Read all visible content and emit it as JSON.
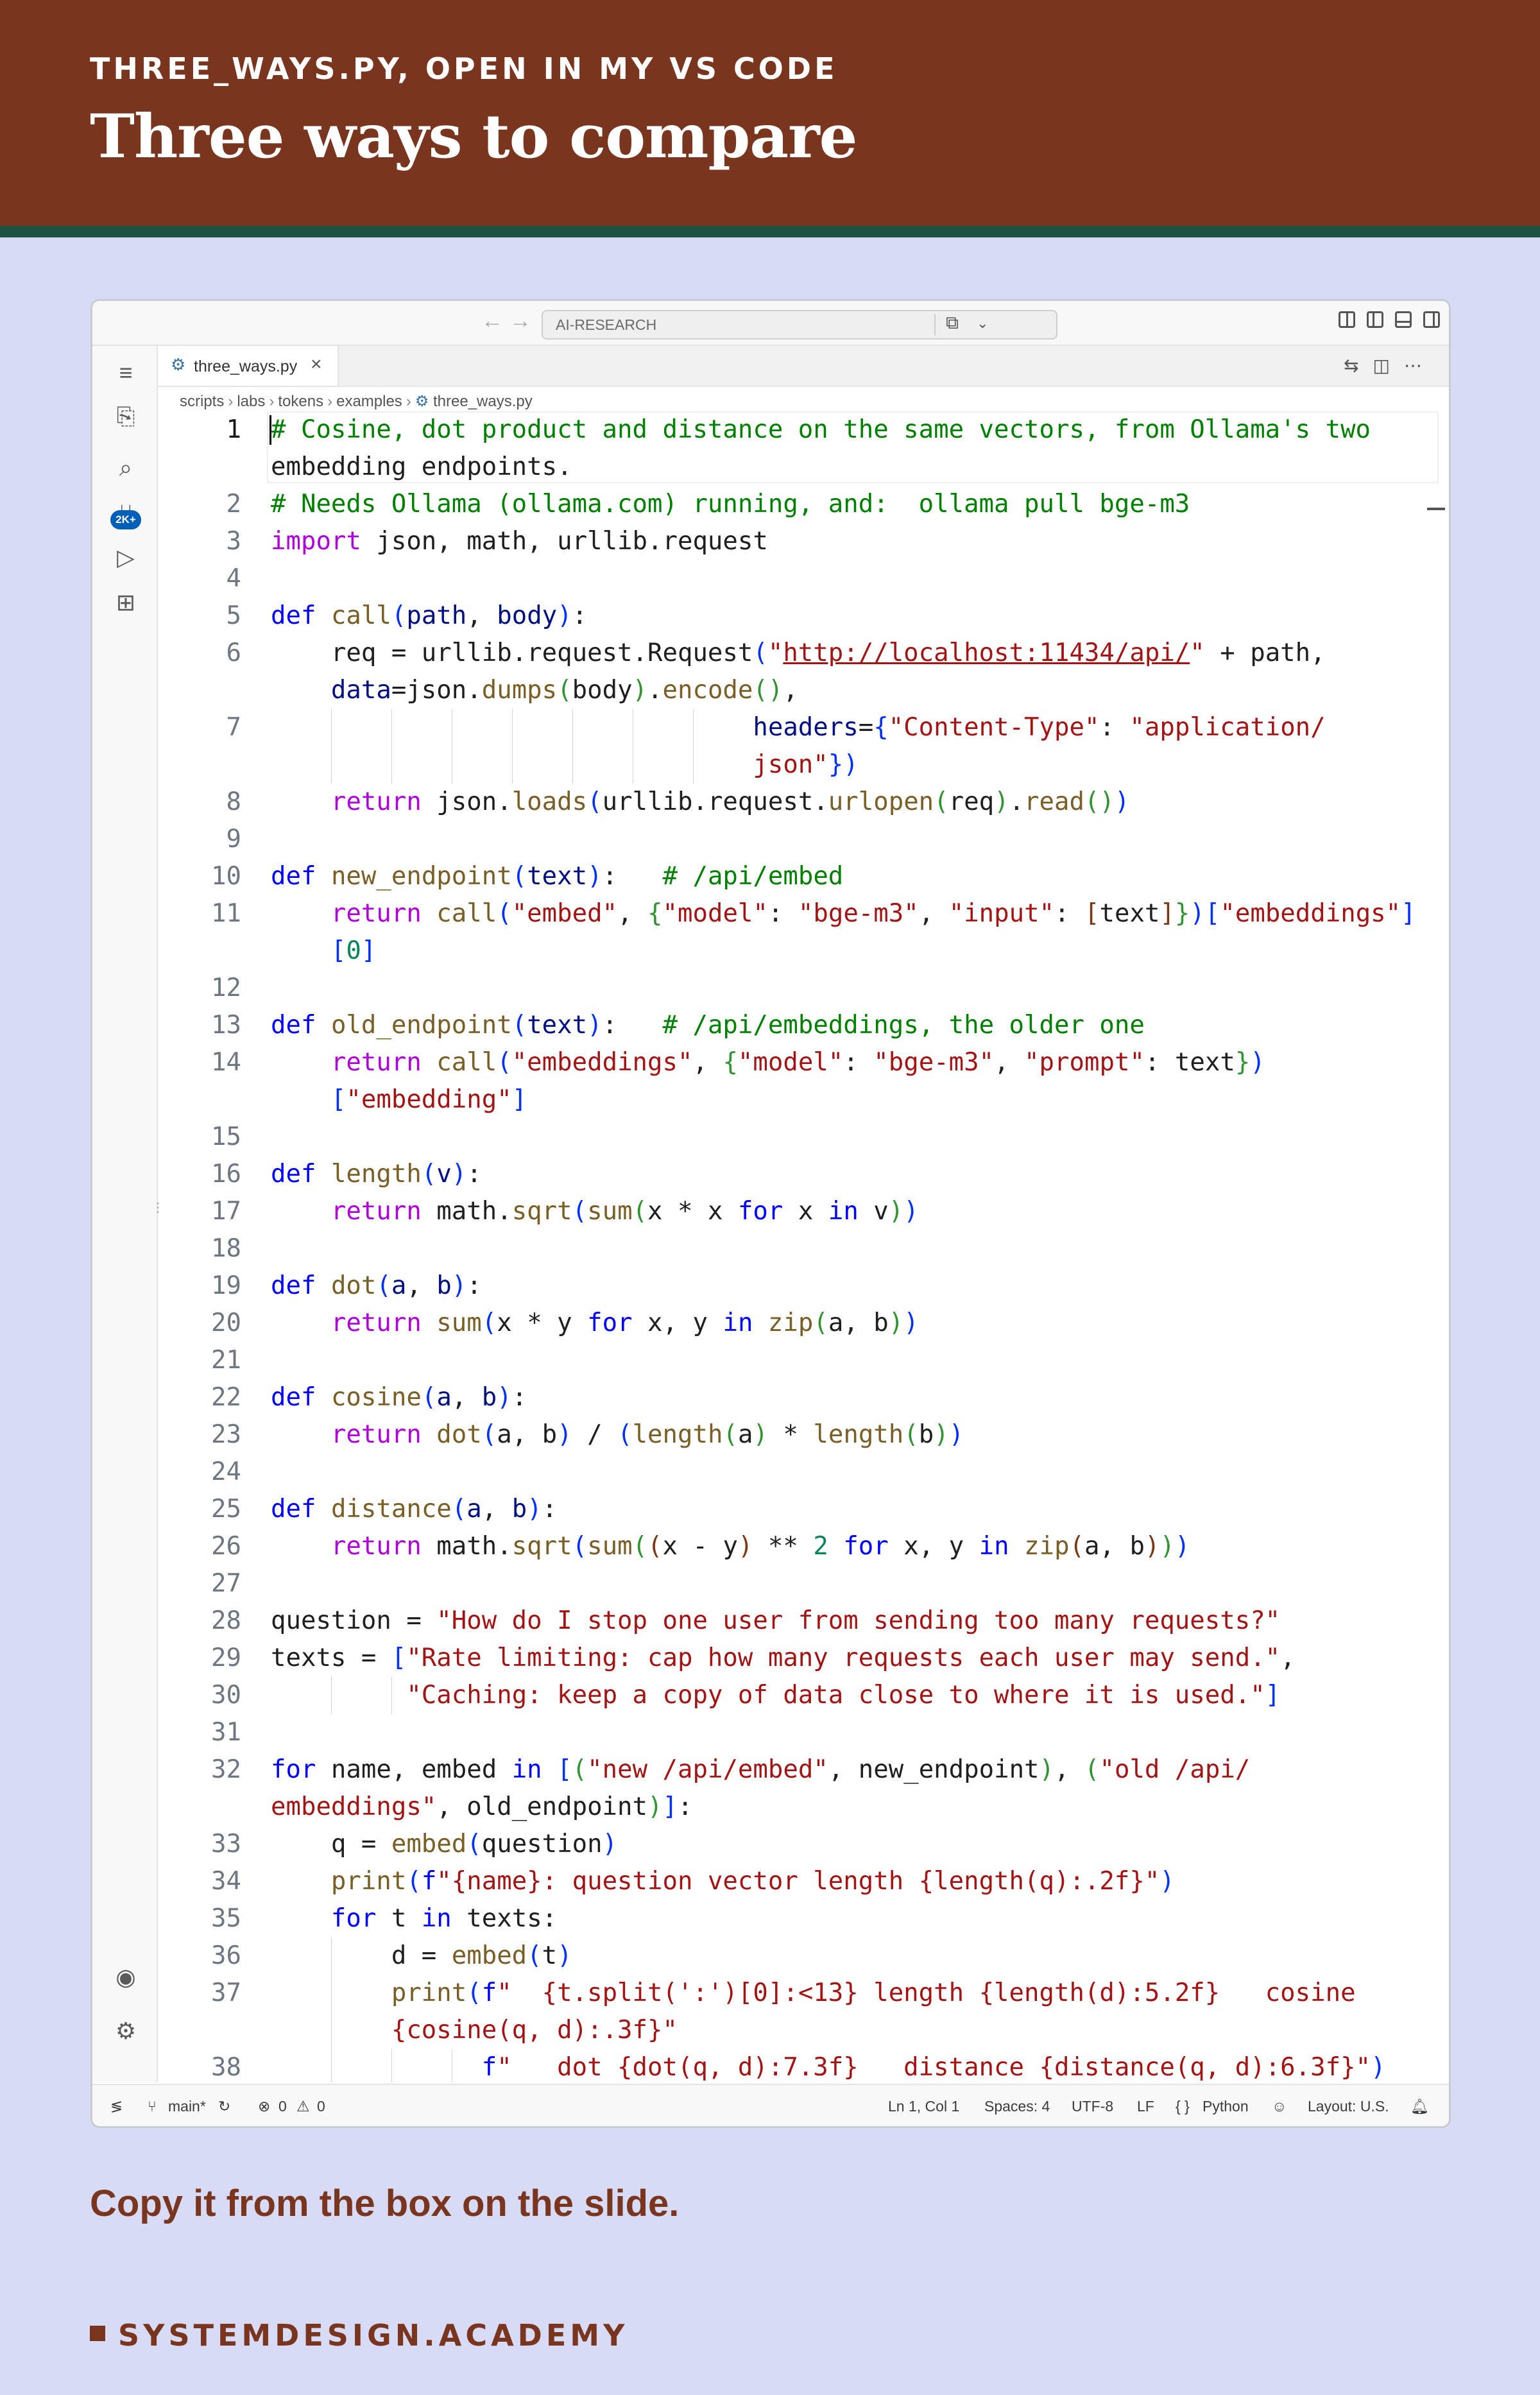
{
  "slide": {
    "eyebrow": "THREE_WAYS.PY, OPEN IN MY VS CODE",
    "title": "Three ways to compare",
    "caption": "Copy it from the box on the slide.",
    "footer": "SYSTEMDESIGN.ACADEMY",
    "colors": {
      "header": "#7a351e",
      "stripe": "#1d5140",
      "background": "#d8dbf6"
    }
  },
  "window": {
    "command_center": "AI-RESEARCH",
    "tab_label": "three_ways.py",
    "source_control_badge": "2K+",
    "breadcrumb": [
      "scripts",
      "labs",
      "tokens",
      "examples",
      "three_ways.py"
    ]
  },
  "status": {
    "branch": "main*",
    "errors": "0",
    "warnings": "0",
    "position": "Ln 1, Col 1",
    "spaces": "Spaces: 4",
    "encoding": "UTF-8",
    "eol": "LF",
    "language": "Python",
    "layout": "Layout: U.S."
  },
  "code": [
    {
      "n": "1",
      "text": "# Cosine, dot product and distance on the same vectors, from Ollama's two",
      "wrap": "embedding endpoints."
    },
    {
      "n": "2",
      "text": "# Needs Ollama (ollama.com) running, and:  ollama pull bge-m3"
    },
    {
      "n": "3",
      "text": "import json, math, urllib.request"
    },
    {
      "n": "4",
      "text": ""
    },
    {
      "n": "5",
      "text": "def call(path, body):"
    },
    {
      "n": "6",
      "text": "    req = urllib.request.Request(\"http://localhost:11434/api/\" + path,",
      "wrap": "    data=json.dumps(body).encode(),"
    },
    {
      "n": "7",
      "text": "                                headers={\"Content-Type\": \"application/",
      "wrap": "                                json\"})"
    },
    {
      "n": "8",
      "text": "    return json.loads(urllib.request.urlopen(req).read())"
    },
    {
      "n": "9",
      "text": ""
    },
    {
      "n": "10",
      "text": "def new_endpoint(text):   # /api/embed"
    },
    {
      "n": "11",
      "text": "    return call(\"embed\", {\"model\": \"bge-m3\", \"input\": [text]})[\"embeddings\"]",
      "wrap": "    [0]"
    },
    {
      "n": "12",
      "text": ""
    },
    {
      "n": "13",
      "text": "def old_endpoint(text):   # /api/embeddings, the older one"
    },
    {
      "n": "14",
      "text": "    return call(\"embeddings\", {\"model\": \"bge-m3\", \"prompt\": text})",
      "wrap": "    [\"embedding\"]"
    },
    {
      "n": "15",
      "text": ""
    },
    {
      "n": "16",
      "text": "def length(v):"
    },
    {
      "n": "17",
      "text": "    return math.sqrt(sum(x * x for x in v))"
    },
    {
      "n": "18",
      "text": ""
    },
    {
      "n": "19",
      "text": "def dot(a, b):"
    },
    {
      "n": "20",
      "text": "    return sum(x * y for x, y in zip(a, b))"
    },
    {
      "n": "21",
      "text": ""
    },
    {
      "n": "22",
      "text": "def cosine(a, b):"
    },
    {
      "n": "23",
      "text": "    return dot(a, b) / (length(a) * length(b))"
    },
    {
      "n": "24",
      "text": ""
    },
    {
      "n": "25",
      "text": "def distance(a, b):"
    },
    {
      "n": "26",
      "text": "    return math.sqrt(sum((x - y) ** 2 for x, y in zip(a, b)))"
    },
    {
      "n": "27",
      "text": ""
    },
    {
      "n": "28",
      "text": "question = \"How do I stop one user from sending too many requests?\""
    },
    {
      "n": "29",
      "text": "texts = [\"Rate limiting: cap how many requests each user may send.\","
    },
    {
      "n": "30",
      "text": "         \"Caching: keep a copy of data close to where it is used.\"]"
    },
    {
      "n": "31",
      "text": ""
    },
    {
      "n": "32",
      "text": "for name, embed in [(\"new /api/embed\", new_endpoint), (\"old /api/",
      "wrap": "embeddings\", old_endpoint)]:"
    },
    {
      "n": "33",
      "text": "    q = embed(question)"
    },
    {
      "n": "34",
      "text": "    print(f\"{name}: question vector length {length(q):.2f}\")"
    },
    {
      "n": "35",
      "text": "    for t in texts:"
    },
    {
      "n": "36",
      "text": "        d = embed(t)"
    },
    {
      "n": "37",
      "text": "        print(f\"  {t.split(':')[0]:<13} length {length(d):5.2f}   cosine",
      "wrap": "        {cosine(q, d):.3f}\""
    },
    {
      "n": "38",
      "text": "              f\"   dot {dot(q, d):7.3f}   distance {distance(q, d):6.3f}\")"
    }
  ]
}
